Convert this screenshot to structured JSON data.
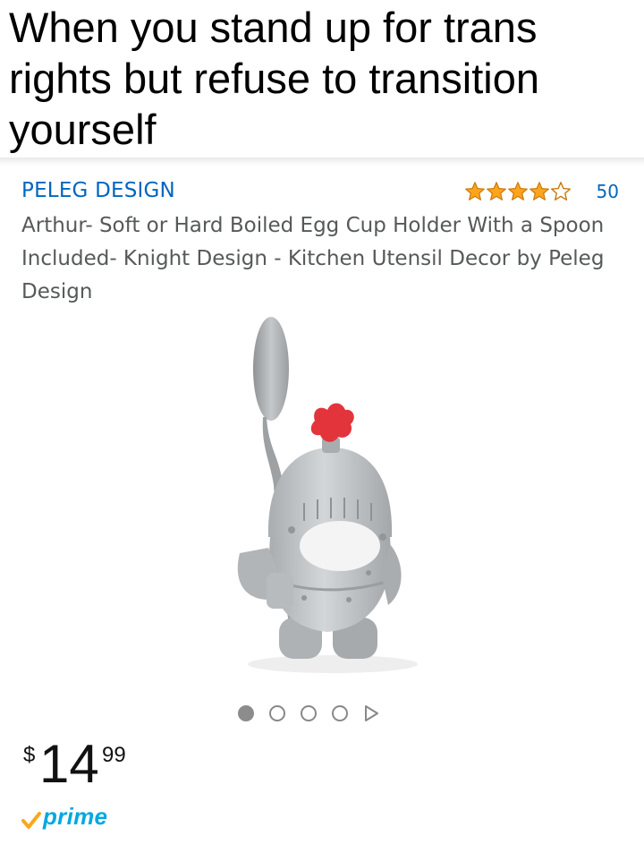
{
  "caption": {
    "text": "When you stand up for trans rights but refuse to transition yourself"
  },
  "product": {
    "brand": "PELEG DESIGN",
    "rating": {
      "stars": 4,
      "max_stars": 5,
      "count": "50"
    },
    "title": "Arthur- Soft or Hard Boiled Egg Cup Holder With a Spoon Included- Knight Design - Kitchen Utensil Decor by Peleg Design",
    "image": {
      "icon": "knight-egg-cup-image"
    },
    "carousel": {
      "total_dots": 4,
      "active_index": 0
    },
    "price": {
      "currency": "$",
      "whole": "14",
      "fraction": "99"
    },
    "prime": {
      "label": "prime"
    }
  },
  "colors": {
    "link": "#0066c0",
    "star": "#ffa41c",
    "prime": "#00a8e1",
    "text_muted": "#565959"
  }
}
